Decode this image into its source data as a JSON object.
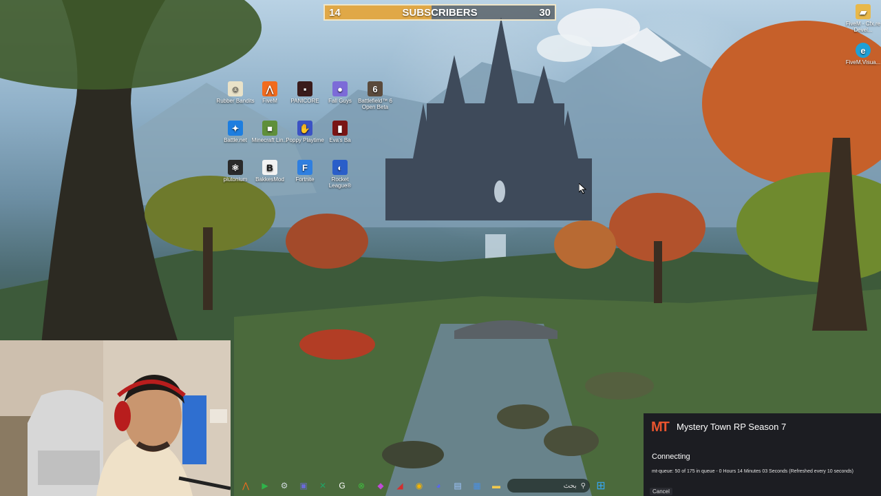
{
  "subscriber_goal": {
    "current": "14",
    "label": "SUBSCRIBERS",
    "goal": "30",
    "progress_fraction": 0.467,
    "fill_color": "#e0a847"
  },
  "desktop_icons": [
    {
      "label": "Rubber Bandits",
      "icon": "rubber-bandits-icon",
      "color": "#e9e2c8"
    },
    {
      "label": "FiveM",
      "icon": "fivem-icon",
      "color": "#f26b1d"
    },
    {
      "label": "PANICORE",
      "icon": "panicore-icon",
      "color": "#3a1b1b"
    },
    {
      "label": "Fall Guys",
      "icon": "fall-guys-icon",
      "color": "#7c6bd8"
    },
    {
      "label": "Battlefield™ 6 Open Beta",
      "icon": "battlefield-icon",
      "color": "#5a4a3c"
    },
    {
      "label": "Battle.net",
      "icon": "battlenet-icon",
      "color": "#1d7ee0"
    },
    {
      "label": "Minecraft Lin...",
      "icon": "minecraft-icon",
      "color": "#5f8f3a"
    },
    {
      "label": "Poppy Playtime",
      "icon": "poppy-playtime-icon",
      "color": "#3b52c4"
    },
    {
      "label": "Eva's Ba",
      "icon": "evas-icon",
      "color": "#7a1515"
    },
    {
      "label": "plutonium",
      "icon": "plutonium-icon",
      "color": "#2a2a2a"
    },
    {
      "label": "BakkesMod",
      "icon": "bakkesmod-icon",
      "color": "#f2f2f2"
    },
    {
      "label": "Fortnite",
      "icon": "fortnite-icon",
      "color": "#2f7fe0"
    },
    {
      "label": "Rocket League®",
      "icon": "rocket-league-icon",
      "color": "#2a5ec9"
    }
  ],
  "right_icons": [
    {
      "label": "FiveM - Cfx.re Devel...",
      "icon": "fivem-dev-icon",
      "color": "#e8b84a"
    },
    {
      "label": "FiveM.Visua...",
      "icon": "edge-icon",
      "color": "#1fa0d6"
    }
  ],
  "taskbar": {
    "search_text": "بحث",
    "icons": [
      {
        "name": "fivem-taskbar-icon",
        "glyph": "⋀",
        "color": "#f26b1d"
      },
      {
        "name": "play-taskbar-icon",
        "glyph": "▶",
        "color": "#2fb34a"
      },
      {
        "name": "steam-taskbar-icon",
        "glyph": "⚙",
        "color": "#cfd8dc"
      },
      {
        "name": "app-taskbar-icon",
        "glyph": "▣",
        "color": "#6a6ad6"
      },
      {
        "name": "excel-taskbar-icon",
        "glyph": "✕",
        "color": "#21a366"
      },
      {
        "name": "g-hub-taskbar-icon",
        "glyph": "G",
        "color": "#ffffff"
      },
      {
        "name": "xbox-taskbar-icon",
        "glyph": "⊗",
        "color": "#3fbf3f"
      },
      {
        "name": "gamepad-taskbar-icon",
        "glyph": "◆",
        "color": "#c04ad8"
      },
      {
        "name": "red-app-taskbar-icon",
        "glyph": "◢",
        "color": "#d32f2f"
      },
      {
        "name": "chrome-taskbar-icon",
        "glyph": "◉",
        "color": "#f4b400"
      },
      {
        "name": "discord-taskbar-icon",
        "glyph": "◕",
        "color": "#5865f2"
      },
      {
        "name": "store-taskbar-icon",
        "glyph": "▤",
        "color": "#9fc7ff"
      },
      {
        "name": "teams-taskbar-icon",
        "glyph": "▦",
        "color": "#4a8fe0"
      },
      {
        "name": "explorer-taskbar-icon",
        "glyph": "▬",
        "color": "#f2c94c"
      }
    ]
  },
  "connect_panel": {
    "server_name": "Mystery Town RP Season 7",
    "logo_text": "MT",
    "status": "Connecting",
    "queue_text": "mt-queue: 50 of 175 in queue - 0 Hours 14 Minutes 03 Seconds (Refreshed every 10 seconds)",
    "cancel_label": "Cancel",
    "logo_color": "#e8542e"
  }
}
